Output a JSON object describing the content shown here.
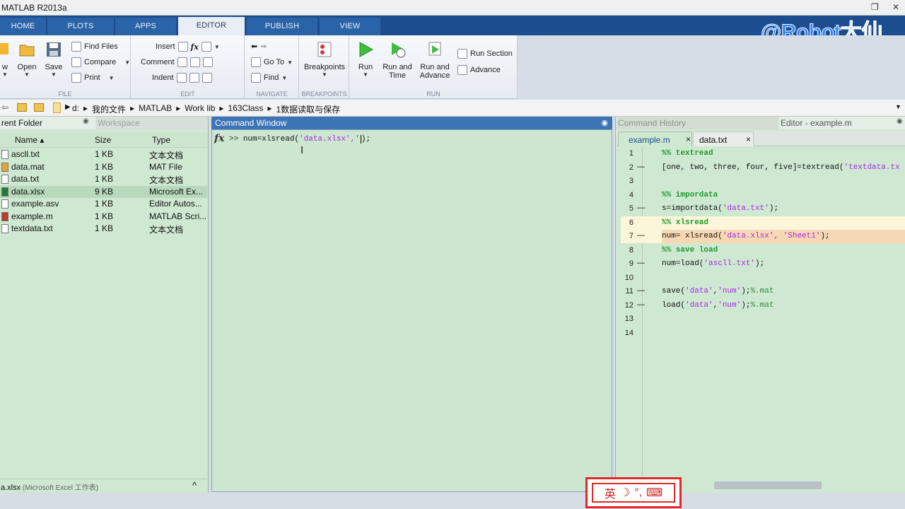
{
  "window": {
    "title": "MATLAB R2013a"
  },
  "ribbon_tabs": [
    {
      "label": "HOME"
    },
    {
      "label": "PLOTS"
    },
    {
      "label": "APPS"
    },
    {
      "label": "EDITOR"
    },
    {
      "label": "PUBLISH"
    },
    {
      "label": "VIEW"
    }
  ],
  "watermark": "@Robot大仙",
  "ribbon": {
    "file": {
      "label": "FILE",
      "new": "w",
      "open": "Open",
      "save": "Save",
      "find_files": "Find Files",
      "compare": "Compare",
      "print": "Print"
    },
    "edit": {
      "label": "EDIT",
      "insert": "Insert",
      "comment": "Comment",
      "indent": "Indent",
      "fx": "fx"
    },
    "navigate": {
      "label": "NAVIGATE",
      "goto": "Go To",
      "find": "Find"
    },
    "breakpoints": {
      "label": "BREAKPOINTS",
      "breakpoints": "Breakpoints"
    },
    "run": {
      "label": "RUN",
      "run": "Run",
      "run_time_1": "Run and",
      "run_time_2": "Time",
      "run_adv_1": "Run and",
      "run_adv_2": "Advance",
      "run_section": "Run Section",
      "advance": "Advance"
    }
  },
  "address": {
    "crumbs": [
      "d:",
      "▸",
      "我的文件",
      "▸",
      "MATLAB",
      "▸",
      "Work lib",
      "▸",
      "163Class",
      "▸",
      "1数据读取与保存"
    ]
  },
  "folder_panel": {
    "title": "rent Folder",
    "tab2": "Workspace",
    "columns": {
      "name": "Name ▴",
      "size": "Size",
      "type": "Type"
    },
    "files": [
      {
        "name": "ascll.txt",
        "size": "1 KB",
        "type": "文本文档",
        "icon_color": "#ffffff"
      },
      {
        "name": "data.mat",
        "size": "1 KB",
        "type": "MAT File",
        "icon_color": "#e0a43a"
      },
      {
        "name": "data.txt",
        "size": "1 KB",
        "type": "文本文档",
        "icon_color": "#ffffff"
      },
      {
        "name": "data.xlsx",
        "size": "9 KB",
        "type": "Microsoft Ex...",
        "icon_color": "#1f7a3a"
      },
      {
        "name": "example.asv",
        "size": "1 KB",
        "type": "Editor Autos...",
        "icon_color": "#ffffff"
      },
      {
        "name": "example.m",
        "size": "1 KB",
        "type": "MATLAB Scri...",
        "icon_color": "#c0392b"
      },
      {
        "name": "textdata.txt",
        "size": "1 KB",
        "type": "文本文档",
        "icon_color": "#ffffff"
      }
    ],
    "status_name": "a.xlsx",
    "status_type": " (Microsoft Excel 工作表)",
    "chevron": "^"
  },
  "command_window": {
    "title": "Command Window",
    "fx": "fx",
    "prompt": ">>",
    "command_pre": "num=xlsread(",
    "command_str": "'data.xlsx','",
    "command_post": ");"
  },
  "history_tab": "Command History",
  "editor": {
    "title": "Editor - example.m",
    "tabs": [
      {
        "label": "example.m"
      },
      {
        "label": "data.txt"
      }
    ],
    "close": "×",
    "lines": [
      {
        "n": "1",
        "dash": "",
        "parts": [
          {
            "t": "%% textread",
            "k": "k"
          }
        ]
      },
      {
        "n": "2",
        "dash": "—",
        "parts": [
          {
            "t": "[one, two, three, four, five]=textread(",
            "k": ""
          },
          {
            "t": "'textdata.tx",
            "k": "s"
          }
        ]
      },
      {
        "n": "3",
        "dash": "",
        "parts": []
      },
      {
        "n": "4",
        "dash": "",
        "parts": [
          {
            "t": "%% impordata",
            "k": "k"
          }
        ]
      },
      {
        "n": "5",
        "dash": "—",
        "parts": [
          {
            "t": "s=importdata(",
            "k": ""
          },
          {
            "t": "'data.txt'",
            "k": "s"
          },
          {
            "t": ");",
            "k": ""
          }
        ]
      },
      {
        "n": "6",
        "dash": "",
        "parts": [
          {
            "t": "%% xlsread",
            "k": "k"
          }
        ]
      },
      {
        "n": "7",
        "dash": "—",
        "parts": [
          {
            "t": "num= xlsread(",
            "k": ""
          },
          {
            "t": "'data.xlsx', 'Sheet1'",
            "k": "s"
          },
          {
            "t": ");",
            "k": ""
          }
        ]
      },
      {
        "n": "8",
        "dash": "",
        "parts": [
          {
            "t": "%% save load",
            "k": "k"
          }
        ]
      },
      {
        "n": "9",
        "dash": "—",
        "parts": [
          {
            "t": "num=load(",
            "k": ""
          },
          {
            "t": "'ascll.txt'",
            "k": "s"
          },
          {
            "t": ");",
            "k": ""
          }
        ]
      },
      {
        "n": "10",
        "dash": "",
        "parts": []
      },
      {
        "n": "11",
        "dash": "—",
        "parts": [
          {
            "t": "save(",
            "k": ""
          },
          {
            "t": "'data'",
            "k": "s"
          },
          {
            "t": ",",
            "k": ""
          },
          {
            "t": "'num'",
            "k": "s"
          },
          {
            "t": ");",
            "k": ""
          },
          {
            "t": "%.mat",
            "k": "c"
          }
        ]
      },
      {
        "n": "12",
        "dash": "—",
        "parts": [
          {
            "t": "load(",
            "k": ""
          },
          {
            "t": "'data'",
            "k": "s"
          },
          {
            "t": ",",
            "k": ""
          },
          {
            "t": "'num'",
            "k": "s"
          },
          {
            "t": ");",
            "k": ""
          },
          {
            "t": "%.mat",
            "k": "c"
          }
        ]
      },
      {
        "n": "13",
        "dash": "",
        "parts": []
      },
      {
        "n": "14",
        "dash": "",
        "parts": []
      }
    ]
  },
  "ime": {
    "lang": "英",
    "moon": "☽",
    "punct": "°,",
    "keyboard": "⌨"
  },
  "colors": {
    "accent": "#3c74b6",
    "panel_green": "#cfe8d1",
    "highlight_section": "#fbf6d9",
    "highlight_line": "#f7d8b5"
  }
}
